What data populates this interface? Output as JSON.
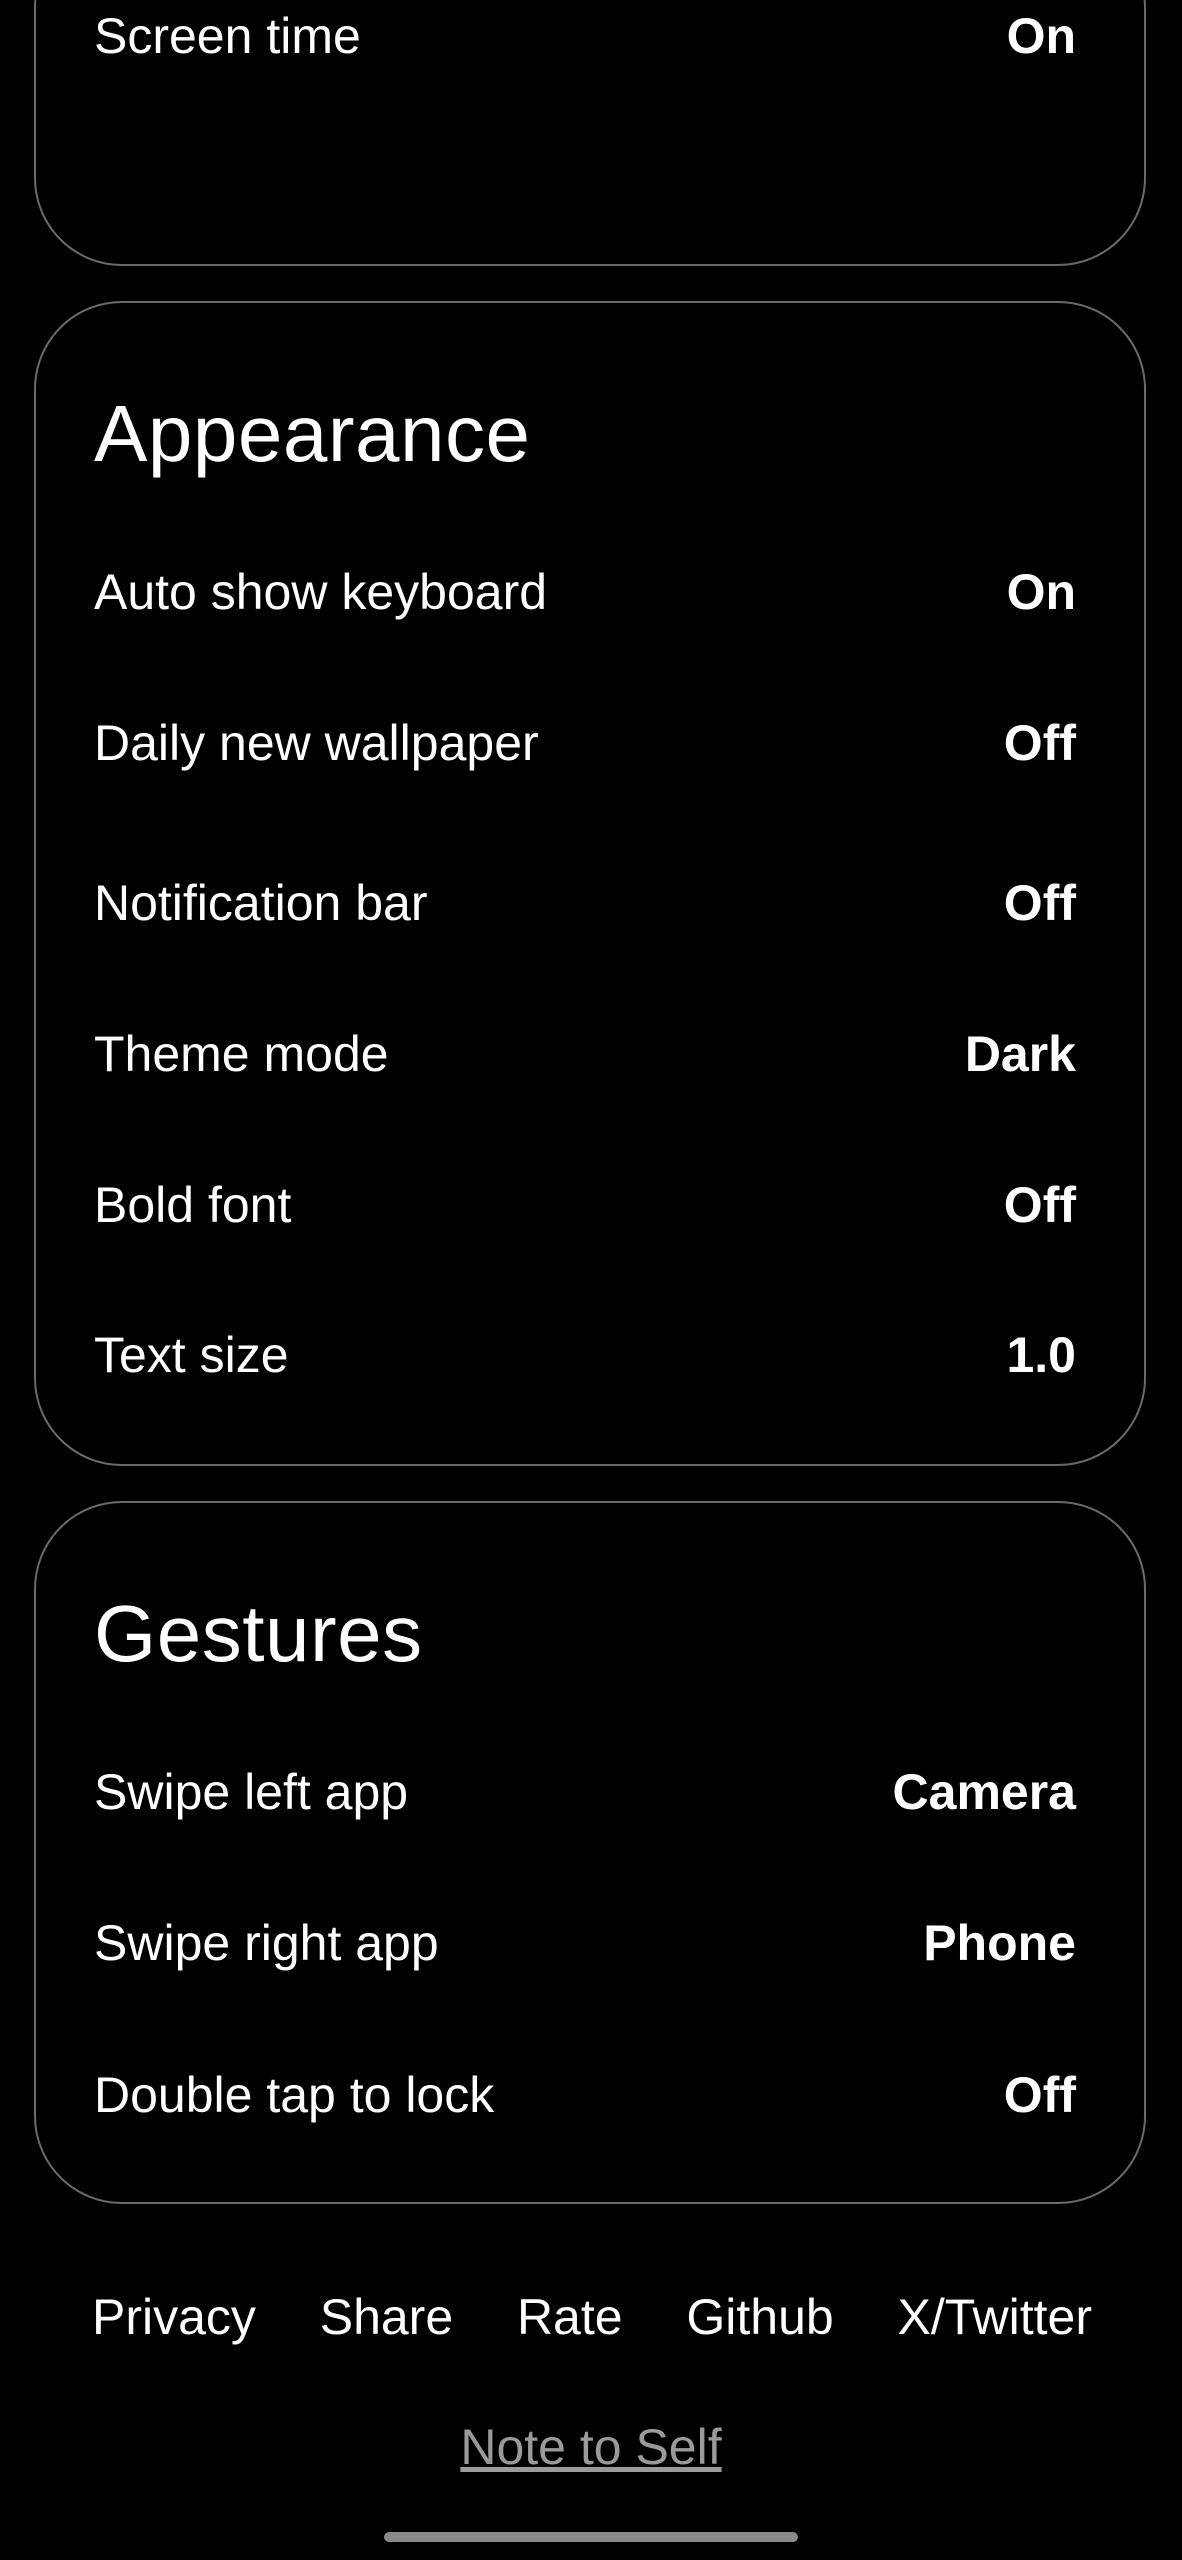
{
  "digital_wellbeing": {
    "rows": [
      {
        "label": "Screen time",
        "value": "On"
      }
    ]
  },
  "appearance": {
    "title": "Appearance",
    "rows": [
      {
        "label": "Auto show keyboard",
        "value": "On"
      },
      {
        "label": "Daily new wallpaper",
        "value": "Off"
      },
      {
        "label": "Notification bar",
        "value": "Off"
      },
      {
        "label": "Theme mode",
        "value": "Dark"
      },
      {
        "label": "Bold font",
        "value": "Off"
      },
      {
        "label": "Text size",
        "value": "1.0"
      }
    ]
  },
  "gestures": {
    "title": "Gestures",
    "rows": [
      {
        "label": "Swipe left app",
        "value": "Camera"
      },
      {
        "label": "Swipe right app",
        "value": "Phone"
      },
      {
        "label": "Double tap to lock",
        "value": "Off"
      }
    ]
  },
  "footer": {
    "links": [
      "Privacy",
      "Share",
      "Rate",
      "Github",
      "X/Twitter"
    ],
    "note_link": "Note to Self"
  },
  "colors": {
    "background": "#000000",
    "text": "#ffffff",
    "card_border": "#6a6a6a",
    "muted_link": "#9a9a9a"
  }
}
